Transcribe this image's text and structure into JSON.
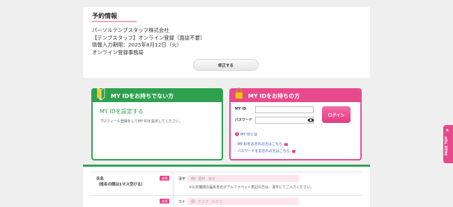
{
  "reservation": {
    "title": "予約情報",
    "lines": [
      "パーソルテンプスタッフ株式会社",
      "【テンプスタッフ】オンライン登録（面談不要）",
      "情報入力期限：2025年8月12日（火）",
      "オンライン登録事務局"
    ],
    "edit_label": "修正する"
  },
  "no_id_panel": {
    "heading": "MY IDをお持ちでない方",
    "set_label": "MY IDを設定する",
    "description": "プロフィール登録をしてMY IDを設定してください。"
  },
  "has_id_panel": {
    "heading": "MY IDをお持ちの方",
    "id_label": "MY ID",
    "password_label": "パスワード",
    "login_label": "ログイン",
    "about_link": "MY IDとは",
    "forgot_id_link": "MY IDをお忘れの方はこちら",
    "forgot_password_link": "パスワードをお忘れの方はこちら"
  },
  "form": {
    "name_label_line1": "氏名",
    "name_label_line2": "（姓名の間は1マス空ける）",
    "required_badge": "必須",
    "kanji_label": "漢字",
    "kanji_placeholder": "例）清村　花子",
    "kanji_note": "※公共機関の届出氏名がアルファベット表記の方は、漢字にてご入力ください。",
    "kana_label": "カナ",
    "kana_placeholder": "例）テンプ　ハナコ"
  },
  "page_top": {
    "label": "PAGE TOP"
  },
  "colors": {
    "green": "#2ea04e",
    "pink": "#e64a8c"
  }
}
